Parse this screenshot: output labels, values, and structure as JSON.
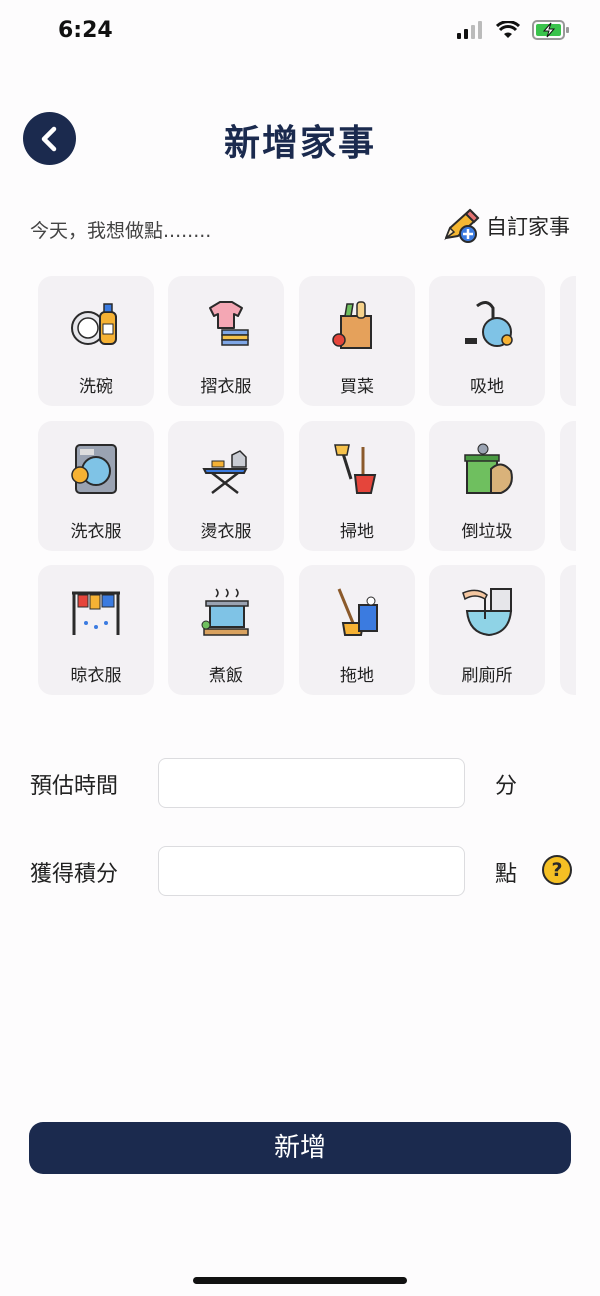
{
  "status": {
    "time": "6:24"
  },
  "header": {
    "title": "新增家事"
  },
  "prompt": {
    "text": "今天，我想做點........",
    "custom_label": "自訂家事"
  },
  "chores": [
    {
      "label": "洗碗",
      "icon": "dish-washing-icon"
    },
    {
      "label": "摺衣服",
      "icon": "fold-clothes-icon"
    },
    {
      "label": "買菜",
      "icon": "grocery-icon"
    },
    {
      "label": "吸地",
      "icon": "vacuum-icon"
    },
    {
      "label": "洗衣服",
      "icon": "washing-machine-icon"
    },
    {
      "label": "燙衣服",
      "icon": "ironing-icon"
    },
    {
      "label": "掃地",
      "icon": "broom-icon"
    },
    {
      "label": "倒垃圾",
      "icon": "trash-icon"
    },
    {
      "label": "晾衣服",
      "icon": "hanging-clothes-icon"
    },
    {
      "label": "煮飯",
      "icon": "cooking-pot-icon"
    },
    {
      "label": "拖地",
      "icon": "mop-icon"
    },
    {
      "label": "刷廁所",
      "icon": "toilet-cleaning-icon"
    }
  ],
  "form": {
    "time_label": "預估時間",
    "time_value": "",
    "time_unit": "分",
    "points_label": "獲得積分",
    "points_value": "",
    "points_unit": "點",
    "help_glyph": "?"
  },
  "submit_label": "新增",
  "colors": {
    "primary": "#1b2a4e",
    "tile": "#f3f1f4",
    "help": "#f5c024"
  }
}
